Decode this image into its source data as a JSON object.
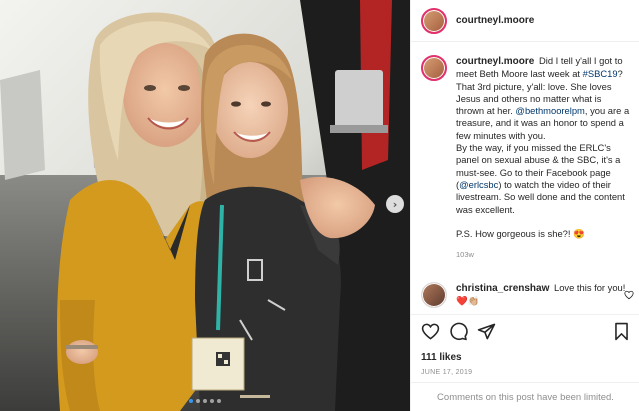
{
  "post": {
    "username": "courtneyl.moore",
    "caption_username": "courtneyl.moore",
    "caption": [
      {
        "t": "Did I tell y'all I got to meet Beth Moore last week at "
      },
      {
        "t": "#SBC19",
        "link": true
      },
      {
        "t": "? That 3rd picture, y'all: love. She loves Jesus and others no matter what is thrown at her. "
      },
      {
        "t": "@bethmoorelpm",
        "link": true
      },
      {
        "t": ", you are a treasure, and it was an honor to spend a few minutes with you."
      }
    ],
    "caption_p2": [
      {
        "t": "By the way, if you missed the ERLC's panel on sexual abuse & the SBC, it's a must-see. Go to their Facebook page ("
      },
      {
        "t": "@erlcsbc",
        "link": true
      },
      {
        "t": ") to watch the video of their livestream. So well done and the content was excellent."
      }
    ],
    "caption_p3": "P.S. How gorgeous is she?! 😍",
    "age": "103w",
    "reply": {
      "username": "christina_crenshaw",
      "text": "Love this for you! ❤️👏🏼"
    },
    "likes": "111 likes",
    "date": "JUNE 17, 2019",
    "comments_limited": "Comments on this post have been limited."
  },
  "carousel": {
    "count": 5,
    "active": 0
  },
  "icons": {
    "like": "heart-icon",
    "comment": "comment-icon",
    "share": "share-icon",
    "save": "bookmark-icon",
    "next": "chevron-right-icon"
  },
  "colors": {
    "link": "#00376b",
    "muted": "#8e8e8e",
    "story_ring": "#e1306c",
    "active_dot": "#3897f0"
  }
}
